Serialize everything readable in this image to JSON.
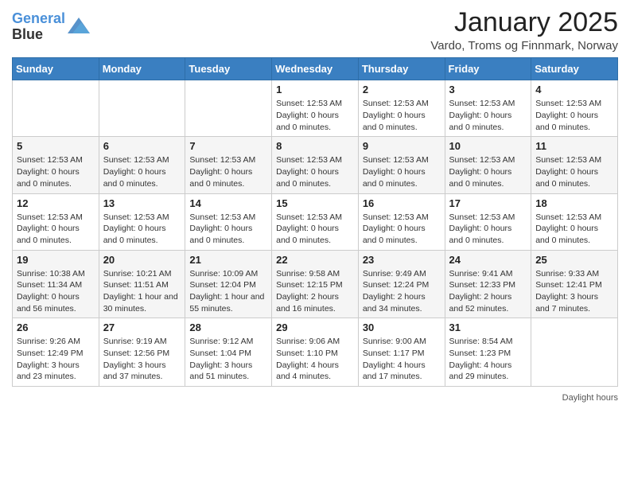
{
  "header": {
    "logo_line1": "General",
    "logo_line2": "Blue",
    "month_title": "January 2025",
    "location": "Vardo, Troms og Finnmark, Norway"
  },
  "days_of_week": [
    "Sunday",
    "Monday",
    "Tuesday",
    "Wednesday",
    "Thursday",
    "Friday",
    "Saturday"
  ],
  "weeks": [
    [
      {
        "day": "",
        "info": ""
      },
      {
        "day": "",
        "info": ""
      },
      {
        "day": "",
        "info": ""
      },
      {
        "day": "1",
        "info": "Sunset: 12:53 AM\nDaylight: 0 hours and 0 minutes."
      },
      {
        "day": "2",
        "info": "Sunset: 12:53 AM\nDaylight: 0 hours and 0 minutes."
      },
      {
        "day": "3",
        "info": "Sunset: 12:53 AM\nDaylight: 0 hours and 0 minutes."
      },
      {
        "day": "4",
        "info": "Sunset: 12:53 AM\nDaylight: 0 hours and 0 minutes."
      }
    ],
    [
      {
        "day": "5",
        "info": "Sunset: 12:53 AM\nDaylight: 0 hours and 0 minutes."
      },
      {
        "day": "6",
        "info": "Sunset: 12:53 AM\nDaylight: 0 hours and 0 minutes."
      },
      {
        "day": "7",
        "info": "Sunset: 12:53 AM\nDaylight: 0 hours and 0 minutes."
      },
      {
        "day": "8",
        "info": "Sunset: 12:53 AM\nDaylight: 0 hours and 0 minutes."
      },
      {
        "day": "9",
        "info": "Sunset: 12:53 AM\nDaylight: 0 hours and 0 minutes."
      },
      {
        "day": "10",
        "info": "Sunset: 12:53 AM\nDaylight: 0 hours and 0 minutes."
      },
      {
        "day": "11",
        "info": "Sunset: 12:53 AM\nDaylight: 0 hours and 0 minutes."
      }
    ],
    [
      {
        "day": "12",
        "info": "Sunset: 12:53 AM\nDaylight: 0 hours and 0 minutes."
      },
      {
        "day": "13",
        "info": "Sunset: 12:53 AM\nDaylight: 0 hours and 0 minutes."
      },
      {
        "day": "14",
        "info": "Sunset: 12:53 AM\nDaylight: 0 hours and 0 minutes."
      },
      {
        "day": "15",
        "info": "Sunset: 12:53 AM\nDaylight: 0 hours and 0 minutes."
      },
      {
        "day": "16",
        "info": "Sunset: 12:53 AM\nDaylight: 0 hours and 0 minutes."
      },
      {
        "day": "17",
        "info": "Sunset: 12:53 AM\nDaylight: 0 hours and 0 minutes."
      },
      {
        "day": "18",
        "info": "Sunset: 12:53 AM\nDaylight: 0 hours and 0 minutes."
      }
    ],
    [
      {
        "day": "19",
        "info": "Sunrise: 10:38 AM\nSunset: 11:34 AM\nDaylight: 0 hours and 56 minutes."
      },
      {
        "day": "20",
        "info": "Sunrise: 10:21 AM\nSunset: 11:51 AM\nDaylight: 1 hour and 30 minutes."
      },
      {
        "day": "21",
        "info": "Sunrise: 10:09 AM\nSunset: 12:04 PM\nDaylight: 1 hour and 55 minutes."
      },
      {
        "day": "22",
        "info": "Sunrise: 9:58 AM\nSunset: 12:15 PM\nDaylight: 2 hours and 16 minutes."
      },
      {
        "day": "23",
        "info": "Sunrise: 9:49 AM\nSunset: 12:24 PM\nDaylight: 2 hours and 34 minutes."
      },
      {
        "day": "24",
        "info": "Sunrise: 9:41 AM\nSunset: 12:33 PM\nDaylight: 2 hours and 52 minutes."
      },
      {
        "day": "25",
        "info": "Sunrise: 9:33 AM\nSunset: 12:41 PM\nDaylight: 3 hours and 7 minutes."
      }
    ],
    [
      {
        "day": "26",
        "info": "Sunrise: 9:26 AM\nSunset: 12:49 PM\nDaylight: 3 hours and 23 minutes."
      },
      {
        "day": "27",
        "info": "Sunrise: 9:19 AM\nSunset: 12:56 PM\nDaylight: 3 hours and 37 minutes."
      },
      {
        "day": "28",
        "info": "Sunrise: 9:12 AM\nSunset: 1:04 PM\nDaylight: 3 hours and 51 minutes."
      },
      {
        "day": "29",
        "info": "Sunrise: 9:06 AM\nSunset: 1:10 PM\nDaylight: 4 hours and 4 minutes."
      },
      {
        "day": "30",
        "info": "Sunrise: 9:00 AM\nSunset: 1:17 PM\nDaylight: 4 hours and 17 minutes."
      },
      {
        "day": "31",
        "info": "Sunrise: 8:54 AM\nSunset: 1:23 PM\nDaylight: 4 hours and 29 minutes."
      },
      {
        "day": "",
        "info": ""
      }
    ]
  ],
  "footer": {
    "note": "Daylight hours"
  }
}
